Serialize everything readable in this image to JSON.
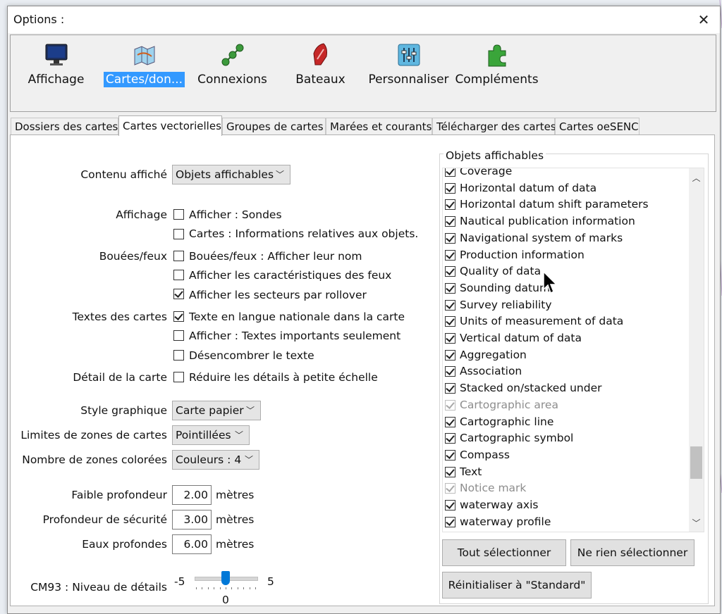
{
  "dialog": {
    "title": "Options :"
  },
  "colors": {
    "selection": "#3399ff",
    "slider": "#0078d7",
    "window_bg": "#f0f0f0"
  },
  "toolbar": {
    "items": [
      {
        "label": "Affichage",
        "icon": "monitor-icon",
        "selected": false
      },
      {
        "label": "Cartes/don...",
        "icon": "charts-icon",
        "selected": true
      },
      {
        "label": "Connexions",
        "icon": "connections-icon",
        "selected": false
      },
      {
        "label": "Bateaux",
        "icon": "boat-icon",
        "selected": false
      },
      {
        "label": "Personnaliser",
        "icon": "sliders-icon",
        "selected": false
      },
      {
        "label": "Compléments",
        "icon": "puzzle-icon",
        "selected": false
      }
    ]
  },
  "tabs": [
    {
      "label": "Dossiers des cartes",
      "active": false
    },
    {
      "label": "Cartes vectorielles",
      "active": true
    },
    {
      "label": "Groupes de cartes",
      "active": false
    },
    {
      "label": "Marées et courants",
      "active": false
    },
    {
      "label": "Télécharger des cartes",
      "active": false
    },
    {
      "label": "Cartes oeSENC",
      "active": false
    }
  ],
  "left": {
    "contenu_label": "Contenu affiché",
    "contenu_value": "Objets affichables",
    "affichage_label": "Affichage",
    "affichage_opts": [
      {
        "label": "Afficher : Sondes",
        "checked": false
      },
      {
        "label": "Cartes : Informations relatives aux objets.",
        "checked": false
      }
    ],
    "bouees_label": "Bouées/feux",
    "bouees_opts": [
      {
        "label": "Bouées/feux : Afficher leur nom",
        "checked": false
      },
      {
        "label": "Afficher les caractéristiques des feux",
        "checked": false
      },
      {
        "label": "Afficher les secteurs par rollover",
        "checked": true
      }
    ],
    "textes_label": "Textes des cartes",
    "textes_opts": [
      {
        "label": "Texte en langue nationale dans la carte",
        "checked": true
      },
      {
        "label": "Afficher : Textes importants seulement",
        "checked": false
      },
      {
        "label": "Désencombrer le texte",
        "checked": false
      }
    ],
    "detail_label": "Détail de la carte",
    "detail_opts": [
      {
        "label": "Réduire les détails à petite échelle",
        "checked": false
      }
    ],
    "style_label": "Style graphique",
    "style_value": "Carte papier",
    "limites_label": "Limites de zones de cartes",
    "limites_value": "Pointillées",
    "zones_label": "Nombre de zones colorées",
    "zones_value": "Couleurs : 4",
    "faible_label": "Faible profondeur",
    "faible_value": "2.00",
    "securite_label": "Profondeur de sécurité",
    "securite_value": "3.00",
    "eaux_label": "Eaux profondes",
    "eaux_value": "6.00",
    "unit": "mètres",
    "cm93_label": "CM93 : Niveau de détails",
    "cm93_min": "-5",
    "cm93_max": "5",
    "cm93_value": "0",
    "cm93_fraction": 0.5
  },
  "objects": {
    "group_title": "Objets affichables",
    "items": [
      {
        "label": "Coverage",
        "checked": true,
        "disabled": false
      },
      {
        "label": "Horizontal datum of data",
        "checked": true,
        "disabled": false
      },
      {
        "label": "Horizontal datum shift parameters",
        "checked": true,
        "disabled": false
      },
      {
        "label": "Nautical publication information",
        "checked": true,
        "disabled": false
      },
      {
        "label": "Navigational system of marks",
        "checked": true,
        "disabled": false
      },
      {
        "label": "Production information",
        "checked": true,
        "disabled": false
      },
      {
        "label": "Quality of data",
        "checked": true,
        "disabled": false
      },
      {
        "label": "Sounding datum",
        "checked": true,
        "disabled": false
      },
      {
        "label": "Survey reliability",
        "checked": true,
        "disabled": false
      },
      {
        "label": "Units of measurement of data",
        "checked": true,
        "disabled": false
      },
      {
        "label": "Vertical datum of data",
        "checked": true,
        "disabled": false
      },
      {
        "label": "Aggregation",
        "checked": true,
        "disabled": false
      },
      {
        "label": "Association",
        "checked": true,
        "disabled": false
      },
      {
        "label": "Stacked on/stacked under",
        "checked": true,
        "disabled": false
      },
      {
        "label": "Cartographic area",
        "checked": true,
        "disabled": true
      },
      {
        "label": "Cartographic line",
        "checked": true,
        "disabled": false
      },
      {
        "label": "Cartographic symbol",
        "checked": true,
        "disabled": false
      },
      {
        "label": "Compass",
        "checked": true,
        "disabled": false
      },
      {
        "label": "Text",
        "checked": true,
        "disabled": false
      },
      {
        "label": "Notice mark",
        "checked": true,
        "disabled": true
      },
      {
        "label": "waterway axis",
        "checked": true,
        "disabled": false
      },
      {
        "label": "waterway profile",
        "checked": true,
        "disabled": false
      }
    ],
    "select_all": "Tout sélectionner",
    "select_none": "Ne rien sélectionner",
    "reset": "Réinitialiser à \"Standard\""
  }
}
